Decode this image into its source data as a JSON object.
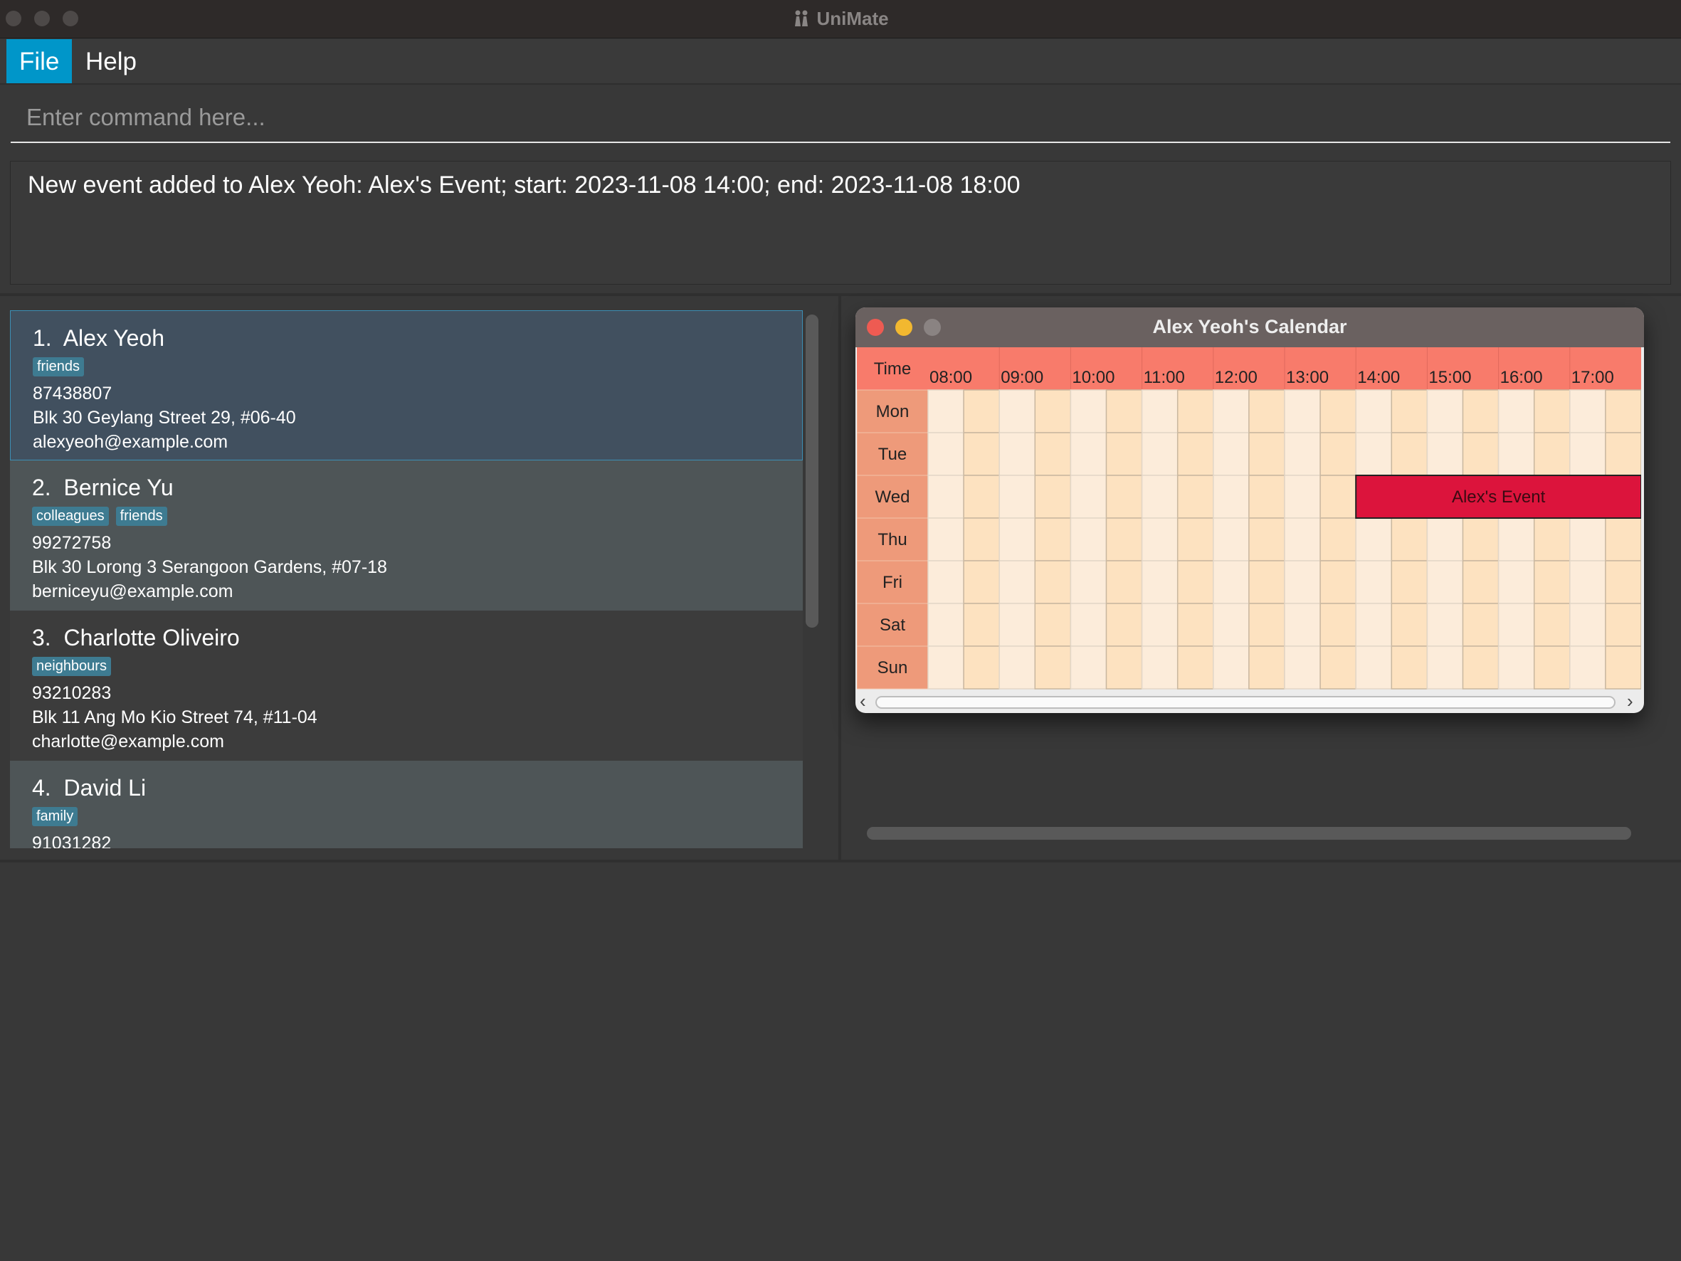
{
  "window": {
    "title": "UniMate"
  },
  "menu": {
    "file": "File",
    "help": "Help"
  },
  "command": {
    "placeholder": "Enter command here...",
    "value": ""
  },
  "result": {
    "message": "New event added to Alex Yeoh: Alex's Event; start: 2023-11-08 14:00; end: 2023-11-08 18:00"
  },
  "persons": [
    {
      "index": "1.",
      "name": "Alex Yeoh",
      "tags": [
        "friends"
      ],
      "phone": "87438807",
      "address": "Blk 30 Geylang Street 29, #06-40",
      "email": "alexyeoh@example.com"
    },
    {
      "index": "2.",
      "name": "Bernice Yu",
      "tags": [
        "colleagues",
        "friends"
      ],
      "phone": "99272758",
      "address": "Blk 30 Lorong 3 Serangoon Gardens, #07-18",
      "email": "berniceyu@example.com"
    },
    {
      "index": "3.",
      "name": "Charlotte Oliveiro",
      "tags": [
        "neighbours"
      ],
      "phone": "93210283",
      "address": "Blk 11 Ang Mo Kio Street 74, #11-04",
      "email": "charlotte@example.com"
    },
    {
      "index": "4.",
      "name": "David Li",
      "tags": [
        "family"
      ],
      "phone": "91031282",
      "address": "",
      "email": ""
    }
  ],
  "calendar": {
    "title": "Alex Yeoh's Calendar",
    "time_header": "Time",
    "hours": [
      "08:00",
      "09:00",
      "10:00",
      "11:00",
      "12:00",
      "13:00",
      "14:00",
      "15:00",
      "16:00",
      "17:00"
    ],
    "days": [
      "Mon",
      "Tue",
      "Wed",
      "Thu",
      "Fri",
      "Sat",
      "Sun"
    ],
    "events": [
      {
        "label": "Alex's Event",
        "day": "Wed",
        "start": "14:00",
        "end": "18:00"
      }
    ],
    "colors": {
      "header": "#f87b6b",
      "day_cell": "#ee9a7a",
      "slot_light": "#fcecda",
      "slot_dark": "#fde2c0",
      "event": "#dc143c"
    }
  }
}
